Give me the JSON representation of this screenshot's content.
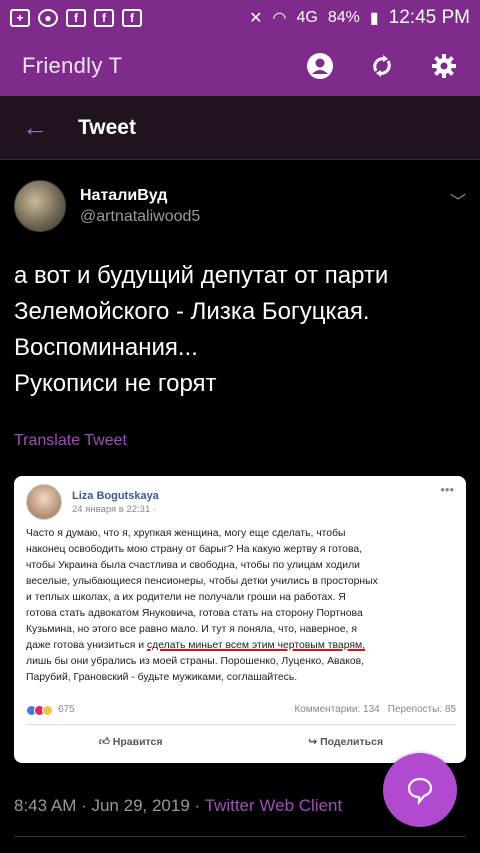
{
  "status_bar": {
    "network": "4G",
    "battery": "84%",
    "time": "12:45 PM",
    "icons": [
      "add-icon",
      "chrome-icon",
      "facebook-icon",
      "facebook-icon",
      "facebook-icon"
    ]
  },
  "app_bar": {
    "title": "Friendly T",
    "icons": [
      "account-icon",
      "refresh-icon",
      "settings-icon"
    ]
  },
  "header": {
    "back_icon": "←",
    "title": "Tweet"
  },
  "tweet": {
    "display_name": "НаталиВуд",
    "handle": "@artnataliwood5",
    "text": "а вот и будущий депутат от парти\nЗелемойского - Лизка Богуцкая.\nВоспоминания...\nРукописи не горят",
    "translate": "Translate Tweet",
    "timestamp": "8:43 AM · Jun 29, 2019 · ",
    "client": "Twitter Web Client"
  },
  "embedded_post": {
    "name": "Liza Bogutskaya",
    "date": "24 января в 22:31 · ",
    "lines": [
      "Часто я думаю, что я, хрупкая женщина, могу еще сделать, чтобы",
      "наконец освободить мою страну от барыг? На какую жертву я готова,",
      "чтобы Украина была счастлива и свободна, чтобы по улицам ходили",
      "веселые, улыбающиеся пенсионеры, чтобы детки учились в просторных",
      "и теплых школах, а их родители не получали гроши на работах. Я",
      "готова стать адвокатом Януковича, готова стать на сторону Портнова",
      "Кузьмина, но этого все равно мало. И тут я поняла, что, наверное, я",
      "даже готова унизиться и ",
      "сделать миньет всем этим чертовым тварям,",
      "лишь бы они убрались из моей страны. Порошенко, Луценко, Аваков,",
      "Парубий, Грановский - будьте мужиками, соглашайтесь."
    ],
    "reactions_count": "675",
    "comments": "Комментарии: 134",
    "shares": "Перепосты: 85",
    "like": "Нравится",
    "share": "Поделиться"
  }
}
